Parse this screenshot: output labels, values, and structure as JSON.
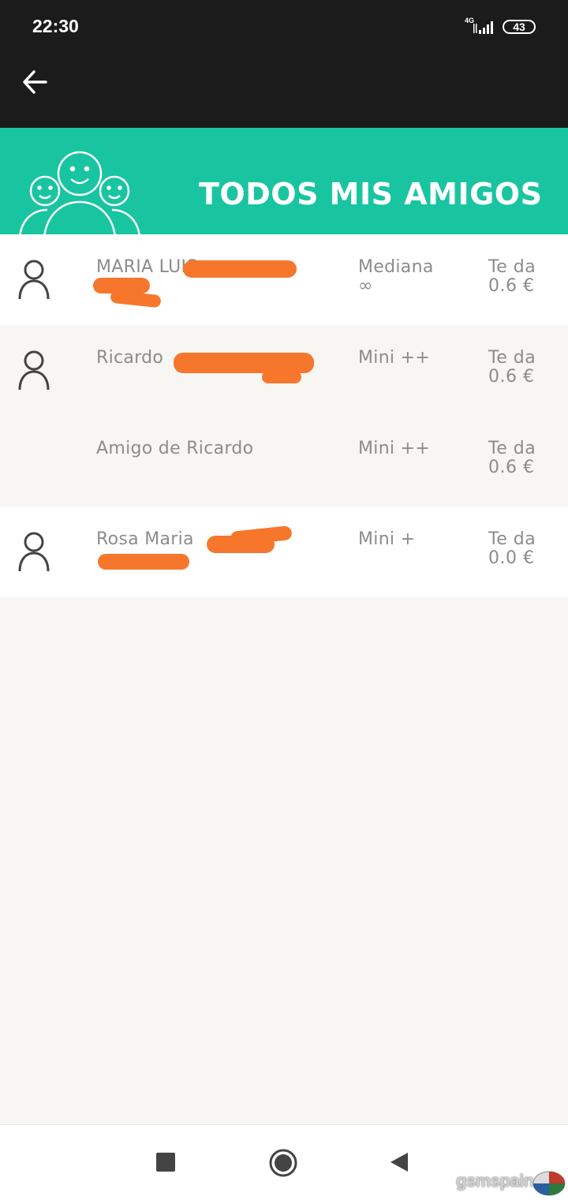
{
  "status_bar": {
    "time": "22:30",
    "network": "4G",
    "battery": "43"
  },
  "banner": {
    "title": "TODOS MIS AMIGOS"
  },
  "friends": [
    {
      "name": "MARIA LUIS",
      "plan": "Mediana\n∞",
      "gives": "Te da\n0.6 €",
      "has_avatar": true,
      "bg": "white"
    },
    {
      "name": "Ricardo",
      "plan": "Mini ++",
      "gives": "Te da\n0.6 €",
      "has_avatar": true,
      "bg": "beige"
    },
    {
      "name": "Amigo de Ricardo",
      "plan": "Mini ++",
      "gives": "Te da\n0.6 €",
      "has_avatar": false,
      "bg": "beige"
    },
    {
      "name": "Rosa Maria",
      "plan": "Mini +",
      "gives": "Te da\n0.0 €",
      "has_avatar": true,
      "bg": "white"
    }
  ],
  "colors": {
    "accent": "#19c5a0",
    "topbar": "#1b1b1b",
    "redaction": "#f6772b",
    "text_muted": "#8c8c8c"
  },
  "watermark": "gsmspain"
}
